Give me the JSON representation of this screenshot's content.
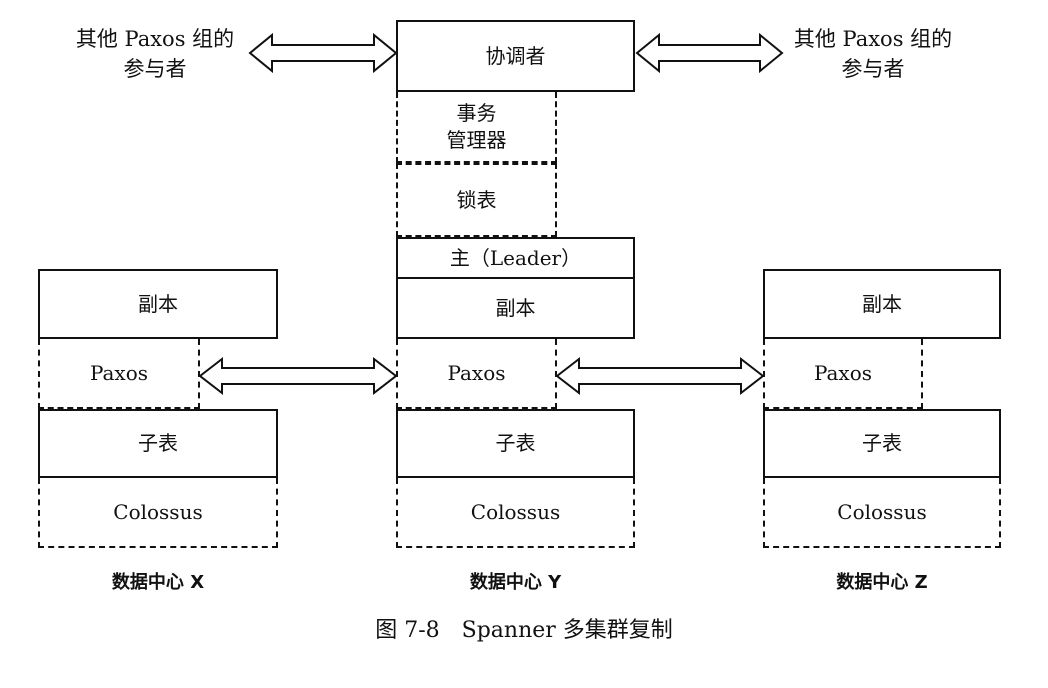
{
  "top": {
    "left_label": [
      "其他 Paxos 组的",
      "参与者"
    ],
    "right_label": [
      "其他 Paxos 组的",
      "参与者"
    ],
    "coordinator": "协调者",
    "txn_manager": [
      "事务",
      "管理器"
    ],
    "lock_table": "锁表",
    "leader": "主（Leader）"
  },
  "datacenters": [
    {
      "replica": "副本",
      "paxos": "Paxos",
      "tablet": "子表",
      "storage": "Colossus",
      "name": "数据中心 X"
    },
    {
      "replica": "副本",
      "paxos": "Paxos",
      "tablet": "子表",
      "storage": "Colossus",
      "name": "数据中心 Y"
    },
    {
      "replica": "副本",
      "paxos": "Paxos",
      "tablet": "子表",
      "storage": "Colossus",
      "name": "数据中心 Z"
    }
  ],
  "caption": "图 7-8　Spanner 多集群复制"
}
